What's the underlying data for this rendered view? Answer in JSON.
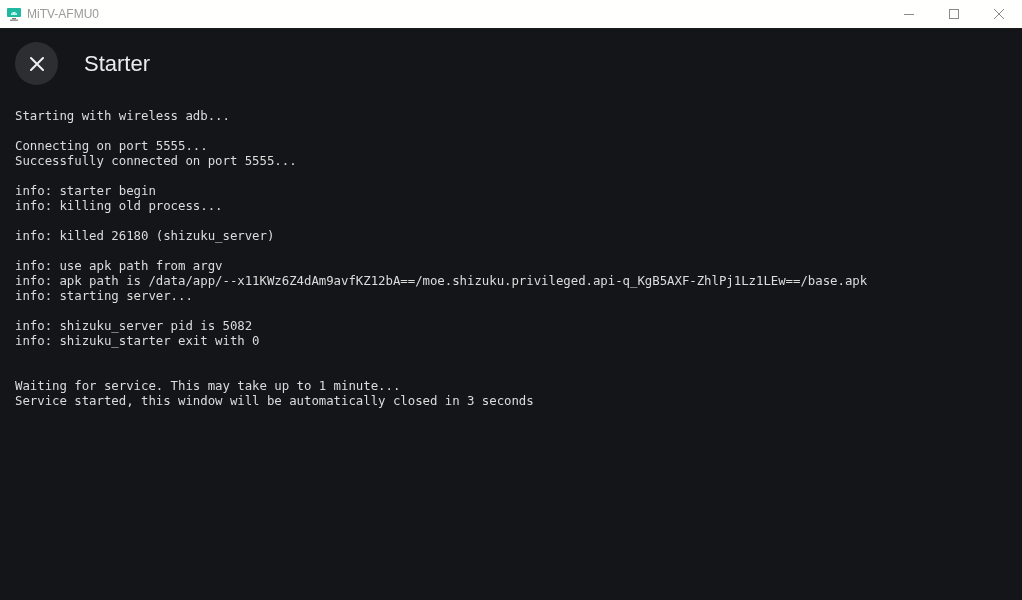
{
  "window": {
    "title": "MiTV-AFMU0"
  },
  "header": {
    "title": "Starter"
  },
  "log": {
    "blocks": [
      {
        "kind": "status",
        "lines": [
          "Starting with wireless adb..."
        ]
      },
      {
        "kind": "output",
        "lines": [
          "Connecting on port 5555...",
          "Successfully connected on port 5555..."
        ]
      },
      {
        "kind": "output",
        "lines": [
          "info: starter begin",
          "info: killing old process..."
        ]
      },
      {
        "kind": "output",
        "lines": [
          "info: killed 26180 (shizuku_server)"
        ]
      },
      {
        "kind": "output",
        "lines": [
          "info: use apk path from argv",
          "info: apk path is /data/app/--x11KWz6Z4dAm9avfKZ12bA==/moe.shizuku.privileged.api-q_KgB5AXF-ZhlPj1Lz1LEw==/base.apk",
          "info: starting server..."
        ]
      },
      {
        "kind": "output",
        "lines": [
          "info: shizuku_server pid is 5082",
          "info: shizuku_starter exit with 0"
        ]
      },
      {
        "kind": "status",
        "lines": [
          "Waiting for service. This may take up to 1 minute...",
          "Service started, this window will be automatically closed in 3 seconds"
        ]
      }
    ]
  }
}
